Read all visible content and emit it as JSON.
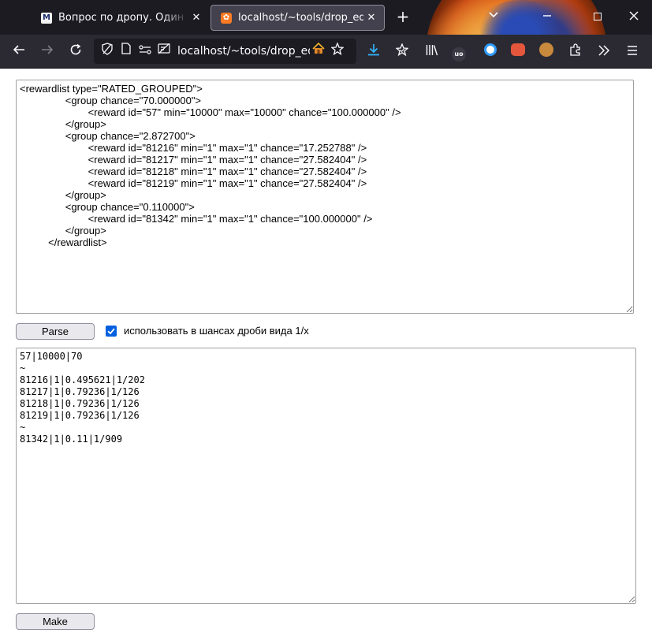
{
  "browser": {
    "tabs": [
      {
        "title": "Вопрос по дропу. Один предмет",
        "favicon": "M",
        "close": "✕",
        "active": false
      },
      {
        "title": "localhost/~tools/drop_ed/?",
        "favicon": "✿",
        "close": "✕",
        "active": true
      }
    ],
    "new_tab": "+",
    "url": "localhost/~tools/drop_ed/?",
    "icons": {
      "back": "arrow-left-icon",
      "forward": "arrow-right-icon",
      "reload": "reload-icon",
      "tracking": "shield-icon",
      "page": "page-icon",
      "permissions": "permissions-icon",
      "reader": "reader-icon",
      "home": "home-icon",
      "bookmark": "star-icon",
      "download": "download-icon",
      "pocket": "pocket-icon",
      "library": "library-icon",
      "ublock": "ublock-icon",
      "extensions": "puzzle-icon",
      "overflow": "chevrons-right-icon",
      "menu": "hamburger-icon"
    },
    "ublock_label": "uo",
    "accent": "#0060df"
  },
  "page": {
    "xml_input": "<rewardlist type=\"RATED_GROUPED\">\n                <group chance=\"70.000000\">\n                        <reward id=\"57\" min=\"10000\" max=\"10000\" chance=\"100.000000\" />\n                </group>\n                <group chance=\"2.872700\">\n                        <reward id=\"81216\" min=\"1\" max=\"1\" chance=\"17.252788\" />\n                        <reward id=\"81217\" min=\"1\" max=\"1\" chance=\"27.582404\" />\n                        <reward id=\"81218\" min=\"1\" max=\"1\" chance=\"27.582404\" />\n                        <reward id=\"81219\" min=\"1\" max=\"1\" chance=\"27.582404\" />\n                </group>\n                <group chance=\"0.110000\">\n                        <reward id=\"81342\" min=\"1\" max=\"1\" chance=\"100.000000\" />\n                </group>\n          </rewardlist>",
    "parse_label": "Parse",
    "fraction_checkbox": {
      "checked": true,
      "label": "использовать в шансах дроби вида 1/x"
    },
    "output": "57|10000|70\n~\n81216|1|0.495621|1/202\n81217|1|0.79236|1/126\n81218|1|0.79236|1/126\n81219|1|0.79236|1/126\n~\n81342|1|0.11|1/909",
    "make_label": "Make"
  }
}
